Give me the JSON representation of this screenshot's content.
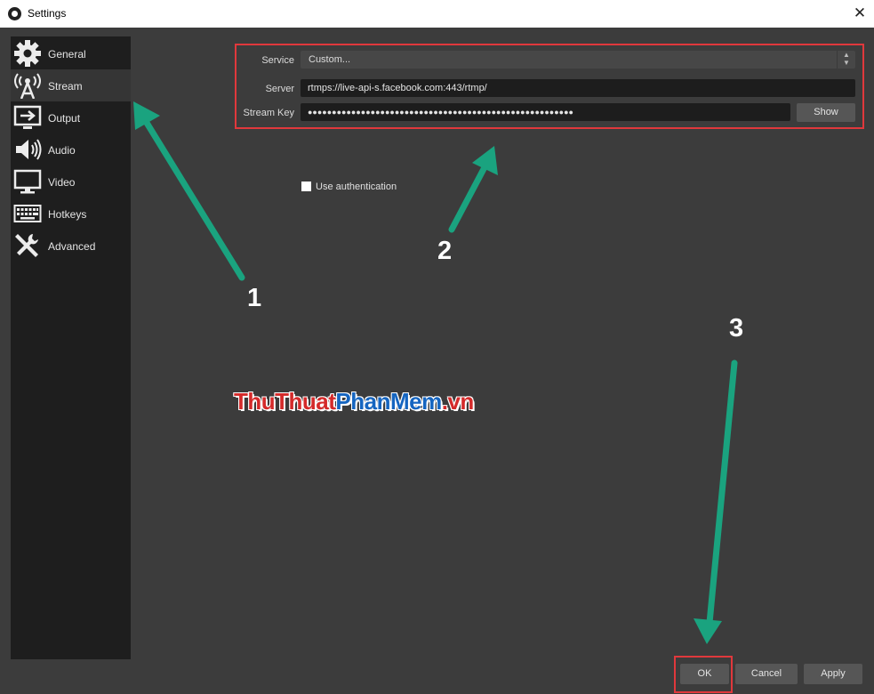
{
  "window": {
    "title": "Settings",
    "close_glyph": "✕"
  },
  "sidebar": {
    "items": [
      {
        "label": "General",
        "icon": "gear-icon"
      },
      {
        "label": "Stream",
        "icon": "antenna-icon",
        "active": true
      },
      {
        "label": "Output",
        "icon": "output-icon"
      },
      {
        "label": "Audio",
        "icon": "speaker-icon"
      },
      {
        "label": "Video",
        "icon": "monitor-icon"
      },
      {
        "label": "Hotkeys",
        "icon": "keyboard-icon"
      },
      {
        "label": "Advanced",
        "icon": "tools-icon"
      }
    ]
  },
  "stream": {
    "service_label": "Service",
    "service_value": "Custom...",
    "server_label": "Server",
    "server_value": "rtmps://live-api-s.facebook.com:443/rtmp/",
    "key_label": "Stream Key",
    "key_value": "●●●●●●●●●●●●●●●●●●●●●●●●●●●●●●●●●●●●●●●●●●●●●●●●●●●●●●●",
    "show_button": "Show",
    "use_auth_label": "Use authentication"
  },
  "footer": {
    "ok": "OK",
    "cancel": "Cancel",
    "apply": "Apply"
  },
  "annotations": {
    "step1": "1",
    "step2": "2",
    "step3": "3"
  },
  "watermark": {
    "part1": "ThuThuat",
    "part2": "PhanMem",
    "part3": ".vn"
  },
  "colors": {
    "highlight": "#e0383c",
    "arrow": "#1aa37f"
  }
}
